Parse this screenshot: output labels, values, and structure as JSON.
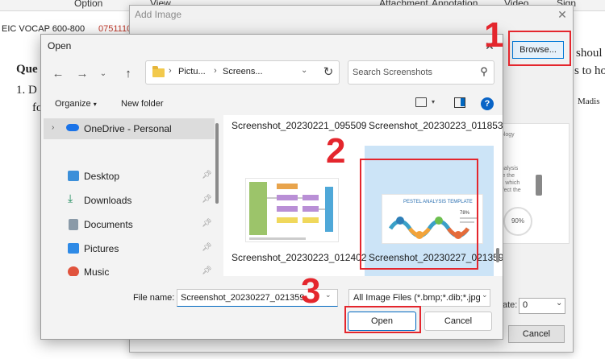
{
  "background_app": {
    "menu_items": [
      "Option",
      "View",
      "Attachment",
      "Annotation",
      "Video",
      "Sign"
    ],
    "tabs": [
      "EIC VOCAP 600-800",
      "07511107"
    ],
    "doc_lines": [
      "Que",
      "1.  D",
      "fo"
    ],
    "doc_right_lines": [
      "shoul",
      "s to ho",
      "Madis"
    ]
  },
  "add_image_dialog": {
    "title": "Add Image",
    "browse_label": "Browse...",
    "preview_texts": [
      "nology",
      "8",
      "analysis",
      "ige the",
      "ns which",
      "affect the",
      "s",
      "90%"
    ],
    "rotate_label": "ate:",
    "rotate_value": "0",
    "cancel_label": "Cancel"
  },
  "open_dialog": {
    "title": "Open",
    "breadcrumbs": [
      "Pictu...",
      "Screens..."
    ],
    "search_placeholder": "Search Screenshots",
    "organize_label": "Organize",
    "new_folder_label": "New folder",
    "nav_items": [
      {
        "label": "OneDrive - Personal",
        "icon": "cloud-icon",
        "color": "#1a73e8"
      },
      {
        "label": "Desktop",
        "icon": "desktop-icon",
        "color": "#3b8fd9"
      },
      {
        "label": "Downloads",
        "icon": "download-icon",
        "color": "#1b8a5a"
      },
      {
        "label": "Documents",
        "icon": "document-icon",
        "color": "#6b7c8c"
      },
      {
        "label": "Pictures",
        "icon": "pictures-icon",
        "color": "#2e8ae6"
      },
      {
        "label": "Music",
        "icon": "music-icon",
        "color": "#e0533d"
      }
    ],
    "files": [
      {
        "name": "Screenshot_20230221_095509"
      },
      {
        "name": "Screenshot_20230223_011853"
      },
      {
        "name": "Screenshot_20230223_012402"
      },
      {
        "name": "Screenshot_20230227_021359",
        "selected": true
      }
    ],
    "thumb_title": "PESTEL ANALYSIS TEMPLATE",
    "thumb_stat": "78%",
    "file_name_label": "File name:",
    "file_name_value": "Screenshot_20230227_021359",
    "file_type_value": "All Image Files (*.bmp;*.dib;*.jpg",
    "open_label": "Open",
    "cancel_label": "Cancel"
  },
  "annotations": {
    "steps": [
      "1",
      "2",
      "3"
    ],
    "highlight_color": "#e4262d"
  }
}
